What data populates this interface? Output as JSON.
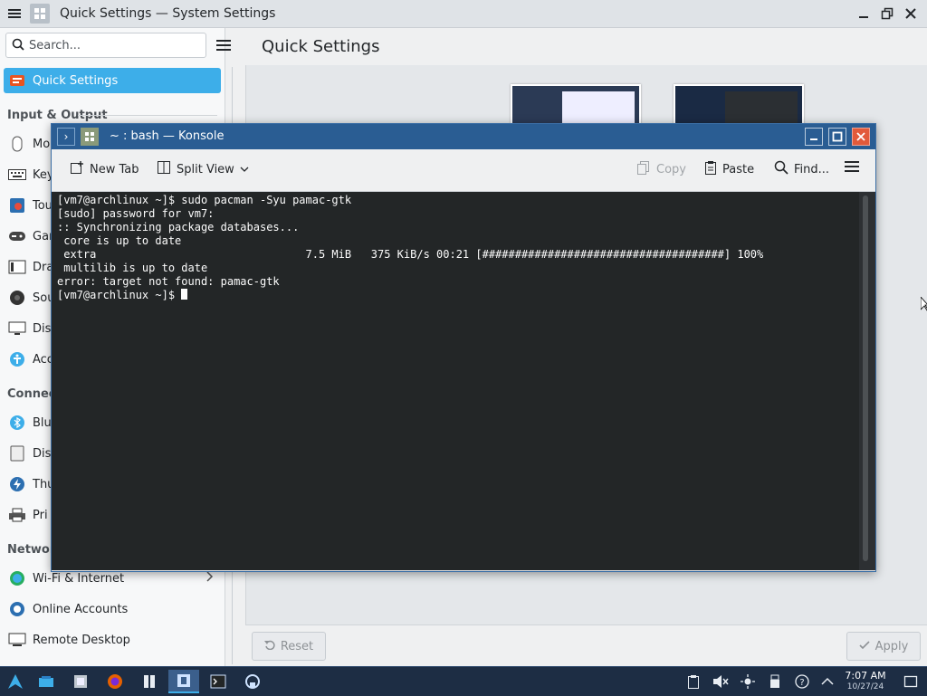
{
  "window": {
    "title": "Quick Settings — System Settings"
  },
  "search": {
    "placeholder": "Search..."
  },
  "sidebar": {
    "selected": "Quick Settings",
    "categories": {
      "input_output": "Input & Output",
      "connected": "Connec",
      "network": "Networ"
    },
    "items": [
      {
        "label": "Quick Settings",
        "icon": "quick-settings-icon"
      },
      {
        "label": "Mo",
        "icon": "mouse-icon"
      },
      {
        "label": "Key",
        "icon": "keyboard-icon"
      },
      {
        "label": "Tou",
        "icon": "touchscreen-icon"
      },
      {
        "label": "Gar",
        "icon": "gamepad-icon"
      },
      {
        "label": "Dra",
        "icon": "drawing-tablet-icon"
      },
      {
        "label": "Sou",
        "icon": "sound-icon"
      },
      {
        "label": "Dis",
        "icon": "display-icon"
      },
      {
        "label": "Acc",
        "icon": "accessibility-icon"
      },
      {
        "label": "Blu",
        "icon": "bluetooth-icon"
      },
      {
        "label": "Dis",
        "icon": "disks-icon"
      },
      {
        "label": "Thu",
        "icon": "thunderbolt-icon"
      },
      {
        "label": "Pri",
        "icon": "printer-icon"
      },
      {
        "label": "Wi-Fi & Internet",
        "icon": "wifi-icon"
      },
      {
        "label": "Online Accounts",
        "icon": "online-accounts-icon"
      },
      {
        "label": "Remote Desktop",
        "icon": "remote-desktop-icon"
      }
    ]
  },
  "main": {
    "title": "Quick Settings"
  },
  "footer": {
    "reset_label": "Reset",
    "apply_label": "Apply"
  },
  "konsole": {
    "title": "~ : bash — Konsole",
    "toolbar": {
      "new_tab": "New Tab",
      "split_view": "Split View",
      "copy": "Copy",
      "paste": "Paste",
      "find": "Find..."
    },
    "terminal_lines": [
      "[vm7@archlinux ~]$ sudo pacman -Syu pamac-gtk",
      "[sudo] password for vm7:",
      ":: Synchronizing package databases...",
      " core is up to date",
      " extra                                7.5 MiB   375 KiB/s 00:21 [#####################################] 100%",
      " multilib is up to date",
      "error: target not found: pamac-gtk",
      "[vm7@archlinux ~]$ "
    ]
  },
  "taskbar": {
    "clock_time": "7:07 AM",
    "clock_date": "10/27/24"
  }
}
